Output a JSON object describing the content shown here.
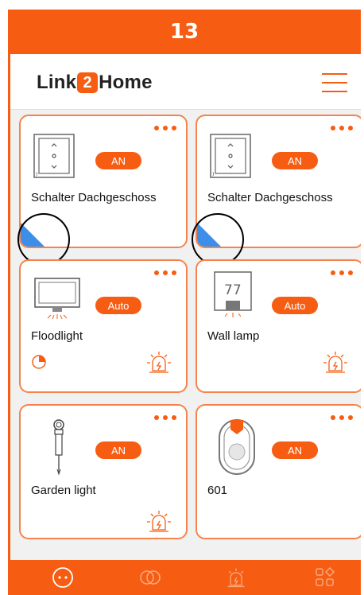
{
  "banner": {
    "step": "13"
  },
  "header": {
    "logo_left": "Link",
    "logo_badge": "2",
    "logo_right": "Home"
  },
  "devices": [
    {
      "name": "Schalter Dachgeschoss",
      "status": "AN"
    },
    {
      "name": "Schalter Dachgeschoss",
      "status": "AN"
    },
    {
      "name": "Floodlight",
      "status": "Auto"
    },
    {
      "name": "Wall lamp",
      "status": "Auto",
      "display_value": "77"
    },
    {
      "name": "Garden light",
      "status": "AN"
    },
    {
      "name": "601",
      "status": "AN"
    }
  ],
  "colors": {
    "accent": "#f65d12",
    "card_border": "#f5844c",
    "indicator": "#3d8ee8"
  },
  "icons": {
    "menu": "hamburger-menu-icon",
    "more": "more-dots-icon",
    "switch": "wall-switch-icon",
    "floodlight": "floodlight-icon",
    "wall_lamp": "wall-lamp-icon",
    "garden": "garden-light-icon",
    "doorbell": "doorbell-icon",
    "alarm": "alarm-light-icon",
    "timer": "timer-pie-icon",
    "tabs": [
      "home-dots-icon",
      "scenes-rings-icon",
      "alarm-tab-icon",
      "grid-apps-icon"
    ]
  }
}
